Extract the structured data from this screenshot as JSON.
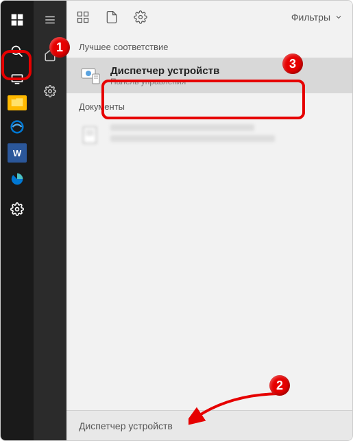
{
  "taskbar": {
    "word_label": "W"
  },
  "panel": {
    "filters_label": "Фильтры",
    "best_match_label": "Лучшее соответствие",
    "documents_label": "Документы"
  },
  "result": {
    "title": "Диспетчер устройств",
    "subtitle": "Панель управления"
  },
  "search": {
    "value": "Диспетчер устройств"
  },
  "annotations": {
    "badge1": "1",
    "badge2": "2",
    "badge3": "3"
  }
}
